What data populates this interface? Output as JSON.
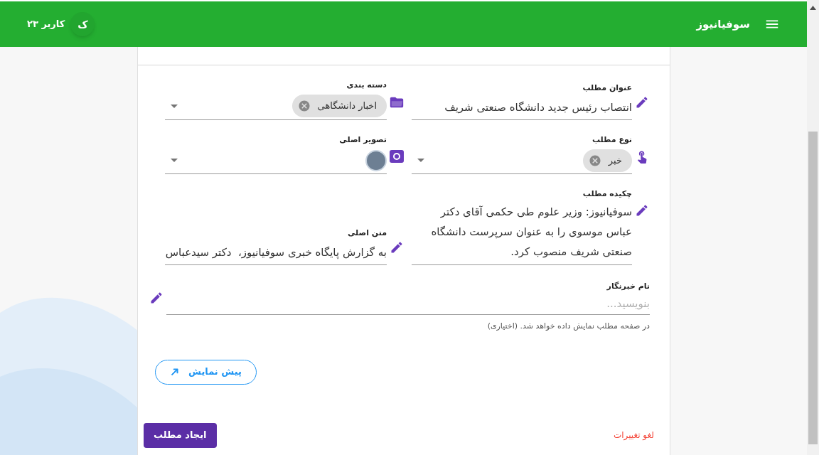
{
  "app_bar": {
    "title": "سوفیانیوز",
    "user_name": "کاربر ۲۳",
    "avatar_letter": "ک"
  },
  "fields": [
    {
      "kind": "text",
      "label": "عنوان مطلب",
      "value": "انتصاب رئیس جدید دانشگاه صنعتی شریف"
    },
    {
      "kind": "category",
      "label": "دسته بندی",
      "chips": [
        "اخبار دانشگاهی"
      ]
    },
    {
      "kind": "posttype",
      "label": "نوع مطلب",
      "chips": [
        "خبر"
      ]
    },
    {
      "kind": "image",
      "label": "تصویر اصلی"
    },
    {
      "kind": "textarea",
      "label": "چکیده مطلب",
      "value": "سوفیانیوز: وزیر علوم طی حکمی آقای دکتر عباس موسوی را به عنوان سرپرست دانشگاه صنعتی شریف منصوب کرد."
    },
    {
      "kind": "text",
      "label": "متن اصلی",
      "value": "به گزارش پایگاه خبری سوفیانیوز،  دکتر سیدعباس"
    }
  ],
  "reporter": {
    "label": "نام خبرنگار",
    "placeholder": "بنویسید...",
    "hint": "در صفحه مطلب نمایش داده خواهد شد. (اختیاری)"
  },
  "preview_button": "پیش نمایش",
  "create_button": "ایجاد مطلب",
  "cancel_link": "لغو تغییرات"
}
